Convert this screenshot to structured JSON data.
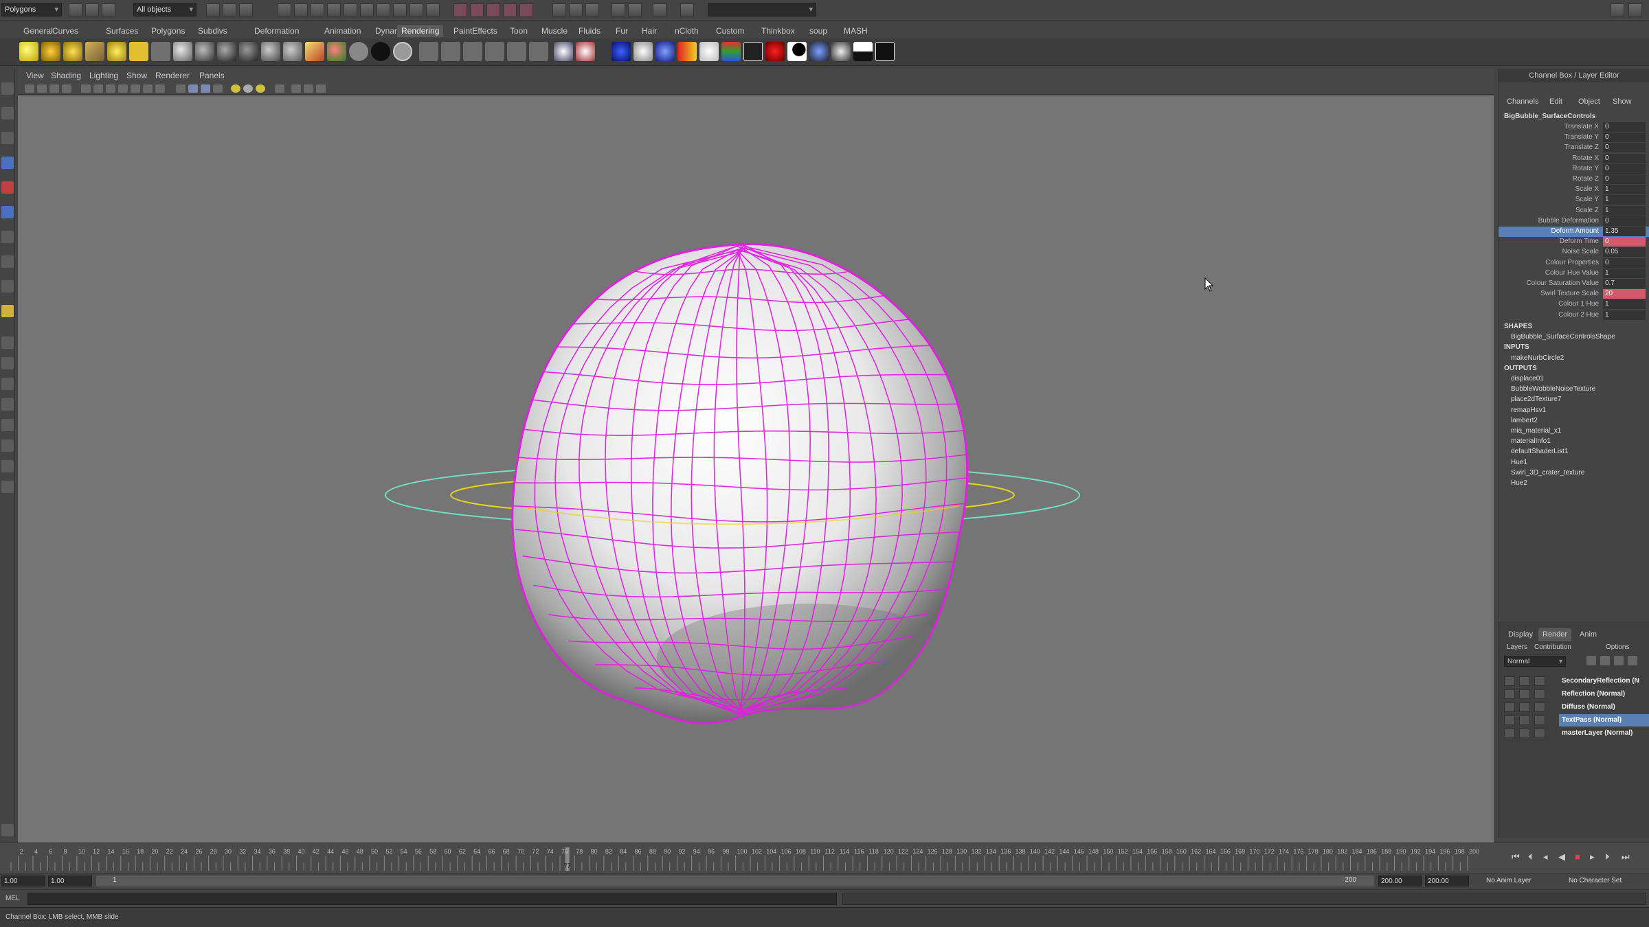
{
  "top_bar": {
    "menu_set": "Polygons",
    "selection_mask": "All objects"
  },
  "shelf_tabs": [
    "General",
    "Curves",
    "Surfaces",
    "Polygons",
    "Subdivs",
    "Deformation",
    "Animation",
    "Dynamics",
    "Rendering",
    "PaintEffects",
    "Toon",
    "Muscle",
    "Fluids",
    "Fur",
    "Hair",
    "nCloth",
    "Custom",
    "Thinkbox",
    "soup",
    "MASH"
  ],
  "shelf_active_tab": "Rendering",
  "panel_menu": [
    "View",
    "Shading",
    "Lighting",
    "Show",
    "Renderer",
    "Panels"
  ],
  "colors": {
    "wireframe": "#e020e0",
    "ring_outer": "#6fe0c0",
    "ring_inner": "#e8d020",
    "selection": "#5a7fb4",
    "keyed_red": "#d25a6a"
  },
  "channel_box": {
    "title": "Channel Box / Layer Editor",
    "menu": [
      "Channels",
      "Edit",
      "Object",
      "Show"
    ],
    "object_name": "BigBubble_SurfaceControls",
    "channels": [
      {
        "name": "Translate X",
        "value": "0",
        "state": ""
      },
      {
        "name": "Translate Y",
        "value": "0",
        "state": ""
      },
      {
        "name": "Translate Z",
        "value": "0",
        "state": ""
      },
      {
        "name": "Rotate X",
        "value": "0",
        "state": ""
      },
      {
        "name": "Rotate Y",
        "value": "0",
        "state": ""
      },
      {
        "name": "Rotate Z",
        "value": "0",
        "state": ""
      },
      {
        "name": "Scale X",
        "value": "1",
        "state": ""
      },
      {
        "name": "Scale Y",
        "value": "1",
        "state": ""
      },
      {
        "name": "Scale Z",
        "value": "1",
        "state": ""
      },
      {
        "name": "Bubble Deformation",
        "value": "0",
        "state": ""
      },
      {
        "name": "Deform Amount",
        "value": "1.35",
        "state": "selected"
      },
      {
        "name": "Deform Time",
        "value": "0",
        "state": "keyed"
      },
      {
        "name": "Noise Scale",
        "value": "0.05",
        "state": ""
      },
      {
        "name": "Colour Properties",
        "value": "0",
        "state": ""
      },
      {
        "name": "Colour Hue Value",
        "value": "1",
        "state": ""
      },
      {
        "name": "Colour Saturation Value",
        "value": "0.7",
        "state": ""
      },
      {
        "name": "Swirl Texture Scale",
        "value": "20",
        "state": "keyed"
      },
      {
        "name": "Colour 1 Hue",
        "value": "1",
        "state": ""
      },
      {
        "name": "Colour 2 Hue",
        "value": "1",
        "state": ""
      }
    ],
    "shapes_label": "SHAPES",
    "shapes": [
      "BigBubble_SurfaceControlsShape"
    ],
    "inputs_label": "INPUTS",
    "inputs": [
      "makeNurbCircle2"
    ],
    "outputs_label": "OUTPUTS",
    "outputs": [
      "displace01",
      "BubbleWobbleNoiseTexture",
      "place2dTexture7",
      "remapHsv1",
      "lambert2",
      "mia_material_x1",
      "materialInfo1",
      "defaultShaderList1",
      "Hue1",
      "Swirl_3D_crater_texture",
      "Hue2"
    ]
  },
  "layer_editor": {
    "tabs": [
      "Display",
      "Render",
      "Anim"
    ],
    "active_tab": "Render",
    "menu": [
      "Layers",
      "Contribution",
      "Options"
    ],
    "blend_mode": "Normal",
    "layers": [
      {
        "name": "SecondaryReflection (N",
        "selected": false
      },
      {
        "name": "Reflection (Normal)",
        "selected": false
      },
      {
        "name": "Diffuse (Normal)",
        "selected": false
      },
      {
        "name": "TextPass (Normal)",
        "selected": true
      },
      {
        "name": "masterLayer (Normal)",
        "selected": false
      }
    ]
  },
  "timeline": {
    "labels": [
      "2",
      "4",
      "6",
      "8",
      "10",
      "12",
      "14",
      "16",
      "18",
      "20",
      "22",
      "24",
      "26",
      "28",
      "30",
      "32",
      "34",
      "36",
      "38",
      "40",
      "42",
      "44",
      "46",
      "48",
      "50",
      "52",
      "54",
      "56",
      "58",
      "60",
      "62",
      "64",
      "66",
      "68",
      "70",
      "72",
      "74",
      "76",
      "78",
      "80",
      "82",
      "84",
      "86",
      "88",
      "90",
      "92",
      "94",
      "96",
      "98",
      "100",
      "102",
      "104",
      "106",
      "108",
      "110",
      "112",
      "114",
      "116",
      "118",
      "120",
      "122",
      "124",
      "126",
      "128",
      "130",
      "132",
      "134",
      "136",
      "138",
      "140",
      "142",
      "144",
      "146",
      "148",
      "150",
      "152",
      "154",
      "156",
      "158",
      "160",
      "162",
      "164",
      "166",
      "168",
      "170",
      "172",
      "174",
      "176",
      "178",
      "180",
      "182",
      "184",
      "186",
      "188",
      "190",
      "192",
      "194",
      "196",
      "198",
      "200"
    ],
    "current_frame_label": "77",
    "current_frame": 77,
    "range_start": 1,
    "range_end": 200
  },
  "range_slider": {
    "start_time": "1.00",
    "playback_start": "1.00",
    "slider_start": "1",
    "slider_end": "200",
    "playback_end": "200.00",
    "end_time": "200.00",
    "anim_layer": "No Anim Layer",
    "character_set": "No Character Set"
  },
  "command_line": {
    "label": "MEL"
  },
  "help_line": {
    "text": "Channel Box: LMB select, MMB slide"
  }
}
